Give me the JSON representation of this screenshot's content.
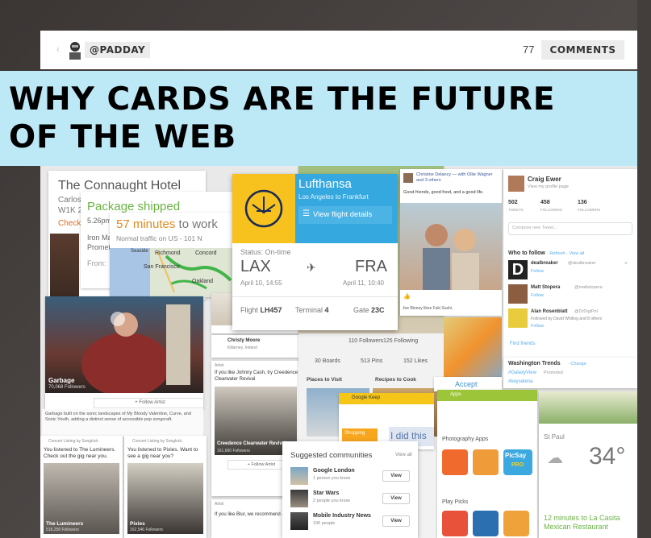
{
  "header": {
    "author": "@PADDAY",
    "comment_count": "77",
    "comments_label": "COMMENTS"
  },
  "headline": {
    "line1": "WHY CARDS ARE THE FUTURE",
    "line2": "OF THE WEB"
  },
  "hotel_card": {
    "title": "The Connaught Hotel",
    "sub1": "Carlos P",
    "sub2": "W1K 2A",
    "checkin": "Check-i"
  },
  "package_card": {
    "title": "Package shipped",
    "time": "5.26pm",
    "line1": "Iron Ma",
    "line2": "Promet",
    "from": "From:"
  },
  "traffic_card": {
    "minutes": "57 minutes",
    "to_work": " to work",
    "sub": "Normal traffic on US - 101 N",
    "map_labels": [
      "Richmond",
      "Concord",
      "San Francisco",
      "Oakland",
      "Seaside",
      "Tr"
    ]
  },
  "flight_card": {
    "airline": "Lufthansa",
    "route": "Los Angeles to Frankfurt",
    "details_btn": "View flight details",
    "status": "Status: On-time",
    "from_code": "LAX",
    "to_code": "FRA",
    "depart": "April 10, 14:55",
    "arrive": "April 11, 10:40",
    "flight_label": "Flight",
    "flight_no": "LH457",
    "terminal_label": "Terminal",
    "terminal_no": "4",
    "gate_label": "Gate",
    "gate_no": "23C"
  },
  "facebook_card": {
    "names": "Christine Delancy — with Ollie Wagner and 3 others",
    "text": "Good friends, good food, and a good life.",
    "footer": "Joe Binney likes Fuki Sushi."
  },
  "twitter_card": {
    "name": "Craig Ewer",
    "link": "View my profile page",
    "tweets": "502",
    "tweets_label": "TWEETS",
    "following": "458",
    "following_label": "FOLLOWING",
    "followers": "136",
    "followers_label": "FOLLOWERS",
    "compose": "Compose new Tweet...",
    "who_to_follow": "Who to follow",
    "refresh": "· Refresh · View all",
    "follow1": "dealbreaker",
    "follow1_handle": "@dealbreaker",
    "follow2": "Matt Stopera",
    "follow2_handle": "@mattstopera",
    "follow3": "Alan Rosenblatt",
    "follow3_handle": "@DrDigiPol",
    "follow3_by": "Followed by David Whiting and 8 others",
    "follow_btn": "Follow",
    "find_friends": "Find friends",
    "trends": "Washington Trends",
    "trends_change": "· Change",
    "trend1": "#GalaxyView",
    "trend1_tag": "Promoted",
    "trend2": "#keyselena"
  },
  "pinterest_card": {
    "followers_count": "110 Followers",
    "following_count": "125 Following",
    "boards": "30 Boards",
    "pins": "513 Pins",
    "likes": "152 Likes",
    "places": "Places to Visit",
    "recipes": "Recipes to Cook",
    "accept": "Accept"
  },
  "music_cards": {
    "garbage": "Garbage",
    "garbage_followers": "70,068 Followers",
    "follow_artist": "+ Follow Artist",
    "garbage_desc": "Garbage built on the sonic landscapes of My Bloody Valentine, Curve, and Sonic Youth, adding a distinct sense of accessible pop songcraft.",
    "concert1_header": "Concert Listing by Songkick",
    "concert1_text": "You listened to The Lumineers. Check out the gig near you.",
    "concert2_text": "You listened to Pixies. Want to see a gig near you?",
    "lumineers": "The Lumineers",
    "lumineers_followers": "518,258 Followers",
    "pixies": "Pixies",
    "pixies_followers": "162,546 Followers",
    "christy": "Christy Moore",
    "christy_venue": "Killarney, Ireland",
    "artist_header": "Artist",
    "ccr_text": "If you like Johnny Cash, try Creedence Clearwater Revival",
    "ccr": "Creedence Clearwater Revival",
    "ccr_followers": "161,660 Followers",
    "blur_text": "If you like Blur, we recommend James"
  },
  "google_now_card": {
    "app": "Google Keep",
    "did_this": "I did this",
    "shopping": "Shopping"
  },
  "communities_card": {
    "title": "Suggested communities",
    "view_all": "View all",
    "items": [
      {
        "name": "Google London",
        "sub": "1 person you know",
        "btn": "View"
      },
      {
        "name": "Star Wars",
        "sub": "2 people you know",
        "btn": "View"
      },
      {
        "name": "Mobile Industry News",
        "sub": "196 people",
        "btn": "View"
      }
    ]
  },
  "play_card": {
    "app": "Apps",
    "section": "Photography Apps",
    "picks": "Play Picks",
    "picsay": "PicSay",
    "pro": "PRO"
  },
  "weather_card": {
    "city": "St Paul",
    "temp": "34°",
    "restaurant": "12 minutes to La Casita Mexican Restaurant"
  },
  "colors": {
    "banner": "#bde9f7",
    "flight_blue": "#36a8e0",
    "flight_yellow": "#f7c11e",
    "google_green": "#6ab344",
    "play_green": "#9cc53a",
    "twitter_blue": "#55acee"
  }
}
